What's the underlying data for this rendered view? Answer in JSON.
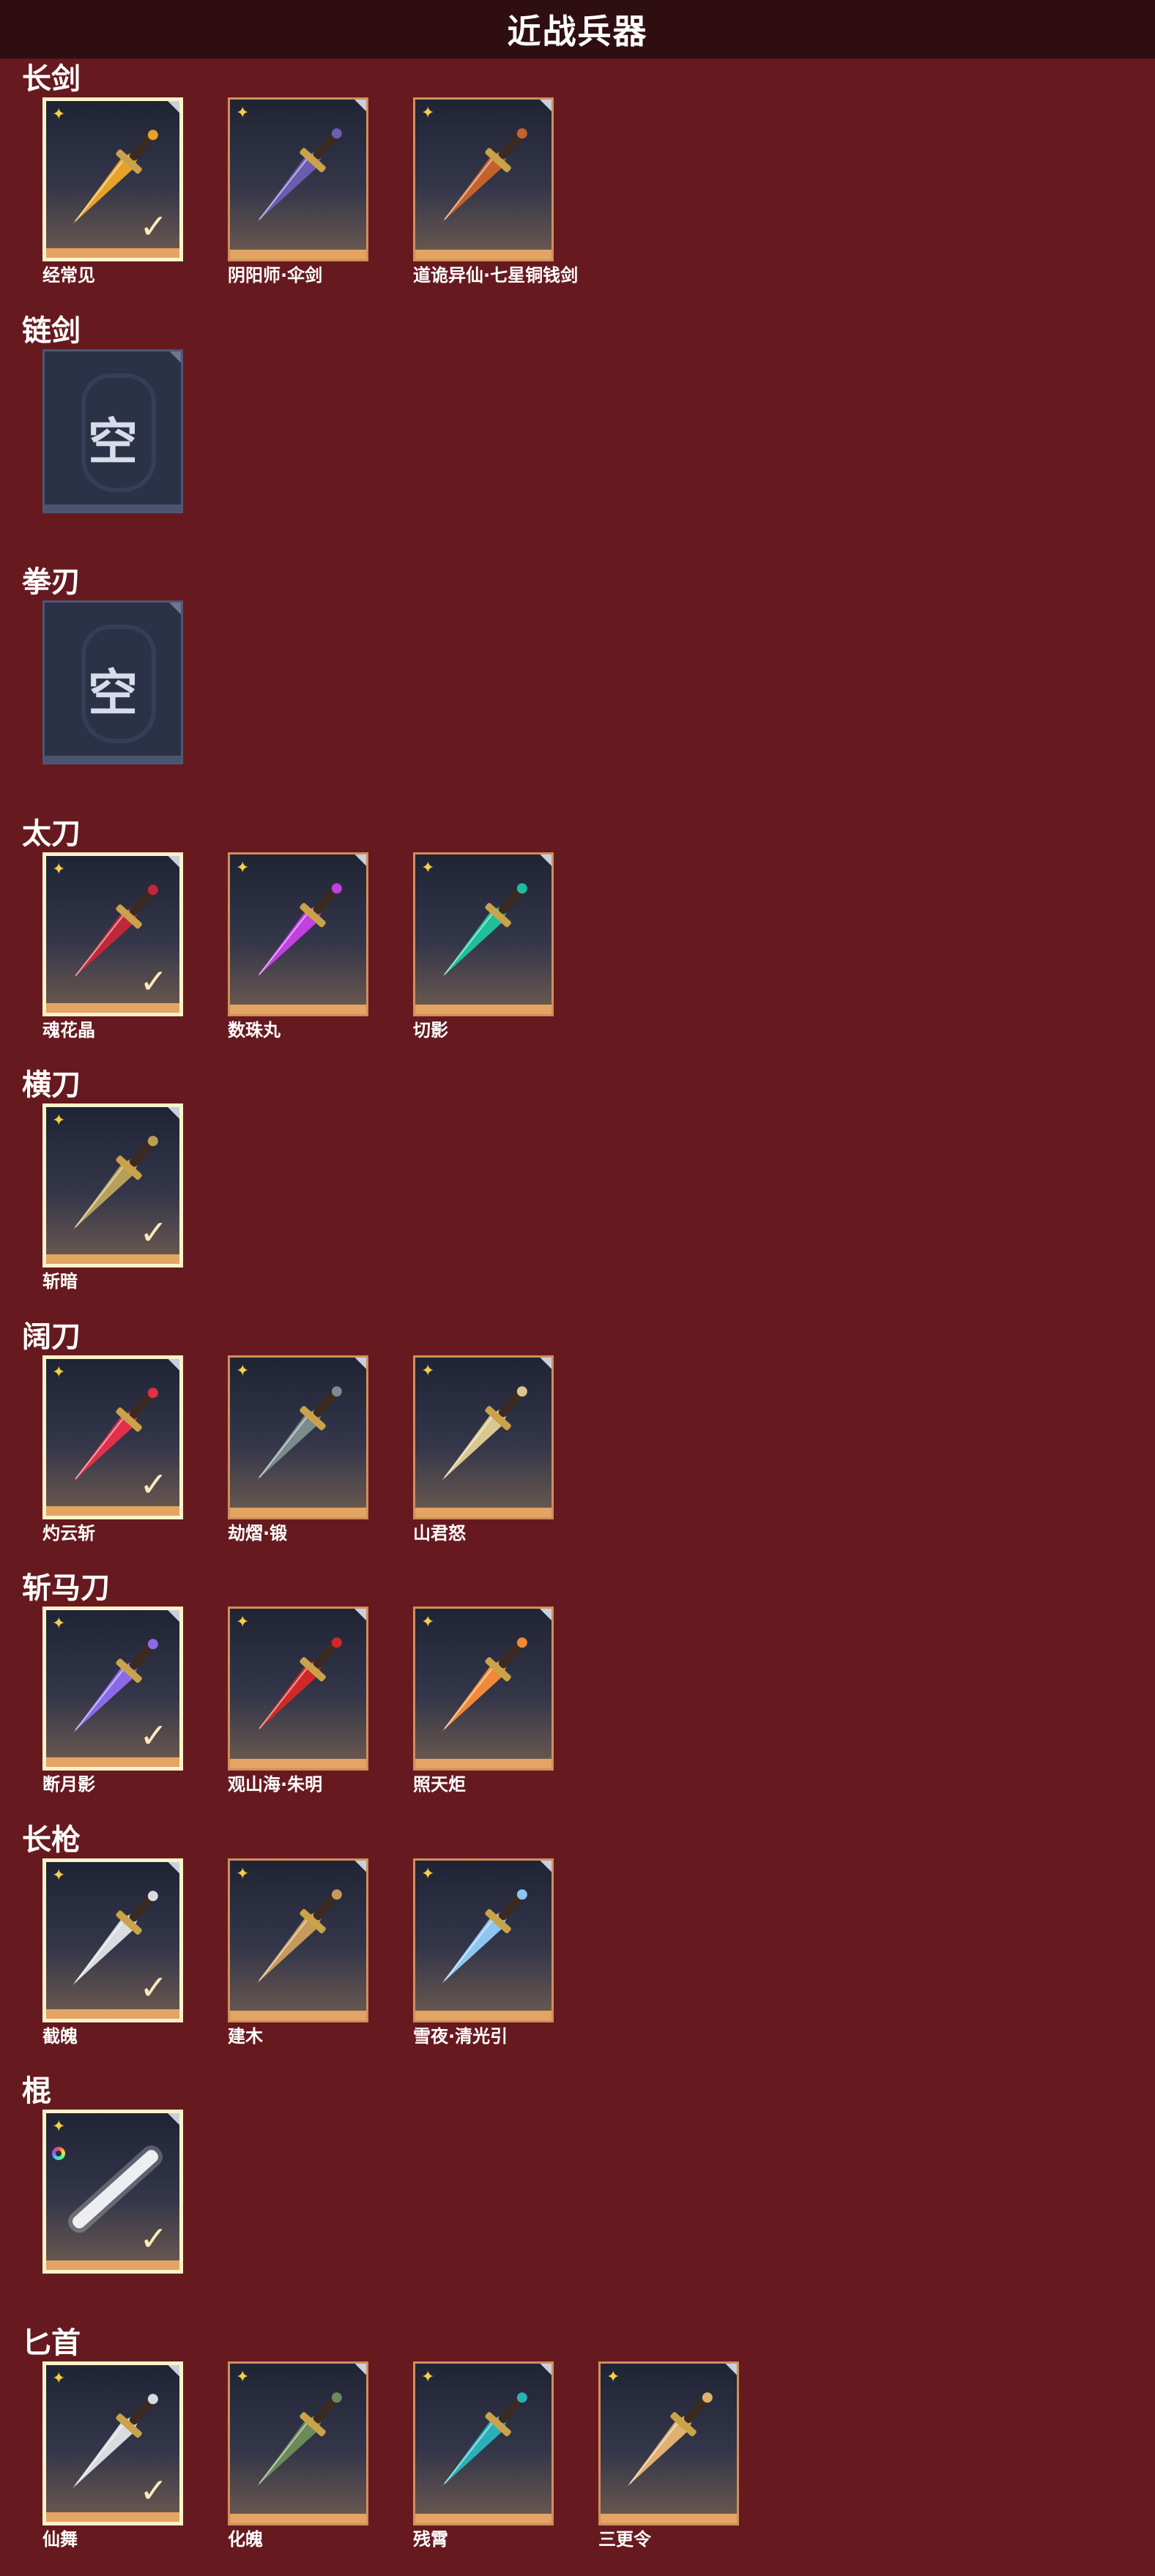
{
  "title": "近战兵器",
  "categories": [
    {
      "name": "长剑",
      "items": [
        {
          "label": "经常见",
          "state": "equipped",
          "color": "#e6a22a",
          "icon": "golden-dragon-sword-icon"
        },
        {
          "label": "阴阳师·伞剑",
          "state": "owned",
          "color": "#6b5cb0",
          "icon": "umbrella-sword-icon"
        },
        {
          "label": "道诡异仙·七星铜钱剑",
          "state": "owned",
          "color": "#c4622e",
          "icon": "coin-sword-icon"
        }
      ]
    },
    {
      "name": "链剑",
      "items": [
        {
          "label": "",
          "state": "empty",
          "empty_text": "空",
          "icon": "empty-slot-icon"
        }
      ]
    },
    {
      "name": "拳刃",
      "items": [
        {
          "label": "",
          "state": "empty",
          "empty_text": "空",
          "icon": "empty-slot-icon"
        }
      ]
    },
    {
      "name": "太刀",
      "items": [
        {
          "label": "魂花晶",
          "state": "equipped",
          "color": "#c0283a",
          "icon": "red-crystal-katana-icon"
        },
        {
          "label": "数珠丸",
          "state": "owned",
          "color": "#c040e0",
          "icon": "purple-katana-icon"
        },
        {
          "label": "切影",
          "state": "owned",
          "color": "#1fbf9a",
          "icon": "jade-katana-icon"
        }
      ]
    },
    {
      "name": "横刀",
      "items": [
        {
          "label": "斩暗",
          "state": "equipped",
          "color": "#b8a05a",
          "icon": "bronze-saber-icon"
        }
      ]
    },
    {
      "name": "阔刀",
      "items": [
        {
          "label": "灼云斩",
          "state": "equipped",
          "color": "#e0304a",
          "icon": "crimson-broadsword-icon"
        },
        {
          "label": "劫熠·锻",
          "state": "owned",
          "color": "#7a8a8e",
          "icon": "dark-broadsword-icon"
        },
        {
          "label": "山君怒",
          "state": "owned",
          "color": "#d8c890",
          "icon": "tiger-broadsword-icon"
        }
      ]
    },
    {
      "name": "斩马刀",
      "items": [
        {
          "label": "断月影",
          "state": "equipped",
          "color": "#8a6ae8",
          "icon": "violet-zhanma-icon"
        },
        {
          "label": "观山海·朱明",
          "state": "owned",
          "color": "#d02828",
          "icon": "scarlet-zhanma-icon"
        },
        {
          "label": "照天炬",
          "state": "owned",
          "color": "#f08a3a",
          "icon": "flame-zhanma-icon"
        }
      ]
    },
    {
      "name": "长枪",
      "items": [
        {
          "label": "截魄",
          "state": "equipped",
          "color": "#d8dce0",
          "icon": "silver-spear-icon"
        },
        {
          "label": "建木",
          "state": "owned",
          "color": "#c69a5a",
          "icon": "wooden-spear-icon"
        },
        {
          "label": "雪夜·清光引",
          "state": "owned",
          "color": "#8ec6f0",
          "icon": "ice-spear-icon"
        }
      ]
    },
    {
      "name": "棍",
      "items": [
        {
          "label": "",
          "state": "equipped",
          "color": "#f4f6f8",
          "icon": "white-staff-icon",
          "dyeable": true
        }
      ]
    },
    {
      "name": "匕首",
      "items": [
        {
          "label": "仙舞",
          "state": "equipped",
          "color": "#d8dce0",
          "icon": "silver-dagger-icon"
        },
        {
          "label": "化魄",
          "state": "owned",
          "color": "#6a8a5a",
          "icon": "green-dagger-icon"
        },
        {
          "label": "残霄",
          "state": "owned",
          "color": "#2ab0b8",
          "icon": "teal-dagger-icon"
        },
        {
          "label": "三更令",
          "state": "owned",
          "color": "#e0b070",
          "icon": "ornate-dagger-icon"
        }
      ]
    }
  ]
}
